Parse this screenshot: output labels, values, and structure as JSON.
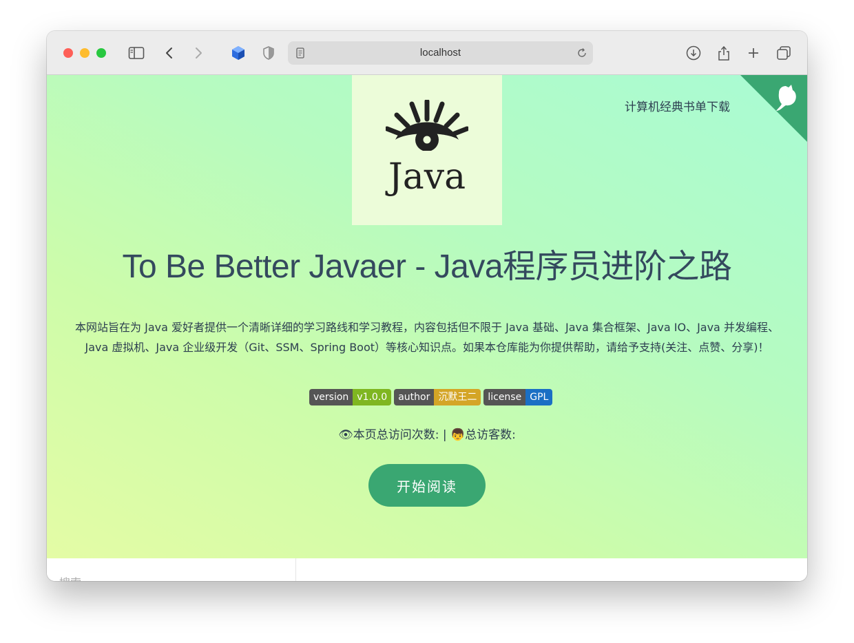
{
  "browser": {
    "url": "localhost",
    "icons": [
      "sidebar-toggle-icon",
      "back-icon",
      "forward-icon",
      "extension-cube-icon",
      "privacy-shield-icon",
      "reader-page-icon",
      "reload-icon",
      "download-icon",
      "share-icon",
      "new-tab-icon",
      "tab-overview-icon"
    ]
  },
  "page": {
    "logo_text": "Java",
    "booklist_link": "计算机经典书单下载",
    "title": "To Be Better Javaer - Java程序员进阶之路",
    "description": "本网站旨在为 Java 爱好者提供一个清晰详细的学习路线和学习教程，内容包括但不限于 Java 基础、Java 集合框架、Java IO、Java 并发编程、Java 虚拟机、Java 企业级开发（Git、SSM、Spring Boot）等核心知识点。如果本仓库能为你提供帮助，请给予支持(关注、点赞、分享)！",
    "badges": [
      {
        "key": "version",
        "value": "v1.0.0",
        "color": "#97ca00"
      },
      {
        "key": "author",
        "value": "沉默王二",
        "color": "#dfb317"
      },
      {
        "key": "license",
        "value": "GPL",
        "color": "#007ec6"
      }
    ],
    "visits": {
      "page_label": "本页总访问次数:",
      "separator": "|",
      "visitor_label": "总访客数:"
    },
    "start_button": "开始阅读",
    "search_label": "搜索"
  },
  "colors": {
    "accent": "#3aa772",
    "text": "#2c3e50"
  }
}
